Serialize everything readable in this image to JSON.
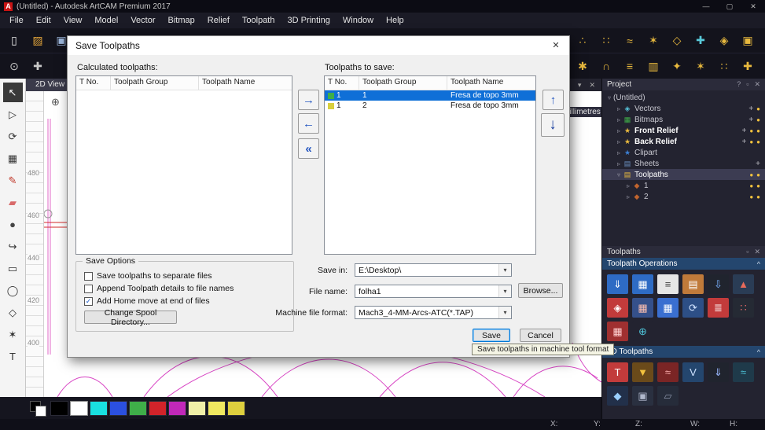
{
  "titlebar": {
    "logo": "A",
    "title": "(Untitled) - Autodesk ArtCAM Premium 2017"
  },
  "icons": {
    "min": "—",
    "max": "▢",
    "close": "✕",
    "help": "?",
    "pin": "▫",
    "dropdown": "▾",
    "collapse": "^",
    "check": "✓"
  },
  "menu": {
    "items": [
      "File",
      "Edit",
      "View",
      "Model",
      "Vector",
      "Bitmap",
      "Relief",
      "Toolpath",
      "3D Printing",
      "Window",
      "Help"
    ]
  },
  "toolbar": {
    "row1_left": [
      {
        "name": "new-model-icon",
        "glyph": "▯",
        "color": "#e8e8e8"
      },
      {
        "name": "open-model-icon",
        "glyph": "▨",
        "color": "#e0a33a"
      },
      {
        "name": "save-model-icon",
        "glyph": "▣",
        "color": "#9ab4d8"
      },
      {
        "name": "import-icon",
        "glyph": "⇩",
        "color": "#8ac08a"
      }
    ],
    "row1_right": [
      {
        "name": "node-editing-icon",
        "glyph": "∴",
        "color": "#e8b93e"
      },
      {
        "name": "add-node-icon",
        "glyph": "∷",
        "color": "#e8b93e"
      },
      {
        "name": "smooth-curve-icon",
        "glyph": "≈",
        "color": "#e8b93e"
      },
      {
        "name": "star-vector-icon",
        "glyph": "✶",
        "color": "#e8b93e"
      },
      {
        "name": "polyline-icon",
        "glyph": "◇",
        "color": "#e8b93e"
      },
      {
        "name": "measure-icon",
        "glyph": "✚",
        "color": "#58c8d8"
      },
      {
        "name": "snap-icon",
        "glyph": "◈",
        "color": "#e8b93e"
      },
      {
        "name": "group-vectors-icon",
        "glyph": "▣",
        "color": "#e8b93e"
      }
    ],
    "row2_left": [
      {
        "name": "zoom-tool-icon",
        "glyph": "⊙",
        "color": "#c8c8c8"
      },
      {
        "name": "pan-tool-icon",
        "glyph": "✚",
        "color": "#c8c8c8"
      }
    ],
    "row2_right": [
      {
        "name": "weld-vectors-icon",
        "glyph": "◉",
        "color": "#e8b93e"
      },
      {
        "name": "trim-vectors-icon",
        "glyph": "✱",
        "color": "#e8b93e"
      },
      {
        "name": "fillet-icon",
        "glyph": "∩",
        "color": "#e8b93e"
      },
      {
        "name": "offset-vector-icon",
        "glyph": "≡",
        "color": "#e8b93e"
      },
      {
        "name": "mirror-vectors-icon",
        "glyph": "▥",
        "color": "#e8b93e"
      },
      {
        "name": "wrap-vectors-icon",
        "glyph": "✦",
        "color": "#e8b93e"
      },
      {
        "name": "nesting-icon",
        "glyph": "✶",
        "color": "#e8b93e"
      },
      {
        "name": "array-copy-icon",
        "glyph": "∷",
        "color": "#e8b93e"
      },
      {
        "name": "join-vectors-icon",
        "glyph": "✚",
        "color": "#e8b93e"
      }
    ]
  },
  "tools": {
    "items": [
      {
        "name": "select-tool",
        "glyph": "↖",
        "active": true
      },
      {
        "name": "node-edit-tool",
        "glyph": "▷"
      },
      {
        "name": "transform-tool",
        "glyph": "⟳"
      },
      {
        "name": "block-copy-tool",
        "glyph": "▦"
      },
      {
        "name": "paint-tool",
        "glyph": "✎",
        "color": "#c0392b"
      },
      {
        "name": "erase-tool",
        "glyph": "▰",
        "color": "#d86a6a"
      },
      {
        "name": "smudge-tool",
        "glyph": "●",
        "color": "#444444"
      },
      {
        "name": "offset-tool",
        "glyph": "↪"
      },
      {
        "name": "rectangle-tool",
        "glyph": "▭"
      },
      {
        "name": "ellipse-tool",
        "glyph": "◯"
      },
      {
        "name": "polygon-tool",
        "glyph": "◇"
      },
      {
        "name": "star-tool",
        "glyph": "✶"
      },
      {
        "name": "text-tool",
        "glyph": "T"
      }
    ]
  },
  "canvas": {
    "view_tab": "2D View -",
    "units": "millimetres",
    "ruler_labels": [
      "480",
      "460",
      "440",
      "420",
      "400"
    ]
  },
  "dialog": {
    "title": "Save Toolpaths",
    "calculated_label": "Calculated toolpaths:",
    "to_save_label": "Toolpaths to save:",
    "columns": [
      "T No.",
      "Toolpath Group",
      "Toolpath Name"
    ],
    "rows": [
      {
        "tno": "1",
        "group": "1",
        "name": "Fresa de topo 3mm",
        "selected": true,
        "icon_color": "#3fae49"
      },
      {
        "tno": "1",
        "group": "2",
        "name": "Fresa de topo 3mm",
        "selected": false,
        "icon_color": "#d8cf3e"
      }
    ],
    "arrows": {
      "right": "→",
      "left": "←",
      "double_left": "«",
      "up": "↑",
      "down": "↓"
    },
    "save_options": {
      "title": "Save Options",
      "checkboxes": [
        {
          "label": "Save toolpaths to separate files",
          "checked": false
        },
        {
          "label": "Append Toolpath details to file names",
          "checked": false
        },
        {
          "label": "Add Home move at end of files",
          "checked": true
        }
      ],
      "spool_button": "Change Spool Directory..."
    },
    "fields": {
      "save_in_label": "Save in:",
      "save_in_value": "E:\\Desktop\\",
      "file_name_label": "File name:",
      "file_name_value": "folha1",
      "browse_button": "Browse...",
      "format_label": "Machine file format:",
      "format_value": "Mach3_4-MM-Arcs-ATC(*.TAP)"
    },
    "save_button": "Save",
    "cancel_button": "Cancel",
    "tooltip": "Save toolpaths in machine tool format"
  },
  "project": {
    "title": "Project",
    "tree": [
      {
        "label": "(Untitled)",
        "level": 0,
        "arrow": "▿"
      },
      {
        "label": "Vectors",
        "level": 1,
        "arrow": "▹",
        "icon": "◈",
        "icon_color": "#57c7de",
        "plus": true,
        "bulbs": 1
      },
      {
        "label": "Bitmaps",
        "level": 1,
        "arrow": "▹",
        "icon": "▦",
        "icon_color": "#3fae49",
        "plus": true,
        "bulbs": 1
      },
      {
        "label": "Front Relief",
        "level": 1,
        "arrow": "▹",
        "icon": "★",
        "icon_color": "#e8b93e",
        "bold": true,
        "plus": true,
        "bulbs": 2
      },
      {
        "label": "Back Relief",
        "level": 1,
        "arrow": "▹",
        "icon": "★",
        "icon_color": "#e8b93e",
        "bold": true,
        "plus": true,
        "bulbs": 2
      },
      {
        "label": "Clipart",
        "level": 1,
        "arrow": "▹",
        "icon": "★",
        "icon_color": "#3b7fd4"
      },
      {
        "label": "Sheets",
        "level": 1,
        "arrow": "▹",
        "icon": "▤",
        "icon_color": "#6a8fc0",
        "plus": true
      },
      {
        "label": "Toolpaths",
        "level": 1,
        "arrow": "▿",
        "icon": "▤",
        "icon_color": "#e8b93e",
        "selected": true,
        "bulbs": 2
      },
      {
        "label": "1",
        "level": 2,
        "arrow": "▹",
        "icon": "◆",
        "icon_color": "#c0642e",
        "bulbs": 2
      },
      {
        "label": "2",
        "level": 2,
        "arrow": "▹",
        "icon": "◆",
        "icon_color": "#c0642e",
        "bulbs": 2
      }
    ]
  },
  "toolpaths_panel": {
    "title": "Toolpaths",
    "ops_title": "Toolpath Operations",
    "ops_icons": [
      {
        "name": "save-toolpaths-icon",
        "glyph": "⇓",
        "fg": "#ffffff",
        "bg": "#2e6bc4"
      },
      {
        "name": "toolpath-summary-icon",
        "glyph": "▦",
        "fg": "#ffffff",
        "bg": "#2e6bc4"
      },
      {
        "name": "toolpath-notes-icon",
        "glyph": "≡",
        "fg": "#444444",
        "bg": "#e6e6e6"
      },
      {
        "name": "toolpath-folder-icon",
        "glyph": "▤",
        "fg": "#ffffff",
        "bg": "#c07a3a"
      },
      {
        "name": "feeds-speeds-icon",
        "glyph": "⇩",
        "fg": "#7ab0ff",
        "bg": "#20242e"
      },
      {
        "name": "simulate-toolpath-icon",
        "glyph": "▲",
        "fg": "#e86a5a",
        "bg": "#2a3c55"
      },
      {
        "name": "delete-simulation-icon",
        "glyph": "◈",
        "fg": "#ffffff",
        "bg": "#c23b3b"
      },
      {
        "name": "material-setup-icon",
        "glyph": "▦",
        "fg": "#ffc0b0",
        "bg": "#35508a"
      },
      {
        "name": "simulation-block-icon",
        "glyph": "▦",
        "fg": "#ffffff",
        "bg": "#3a6fd0"
      },
      {
        "name": "rotate-block-icon",
        "glyph": "⟳",
        "fg": "#cfe2ff",
        "bg": "#2d4f86"
      },
      {
        "name": "toolpath-list-icon",
        "glyph": "≣",
        "fg": "#ffffff",
        "bg": "#c23b3b"
      },
      {
        "name": "preview-quality-icon",
        "glyph": "∷",
        "fg": "#e86a6a",
        "bg": "#252a34"
      },
      {
        "name": "tile-toolpaths-icon",
        "glyph": "▦",
        "fg": "#ffd0d0",
        "bg": "#a03030"
      },
      {
        "name": "set-origin-icon",
        "glyph": "⊕",
        "fg": "#4ec3d8",
        "bg": "#232330"
      }
    ],
    "d2_title": "2D Toolpaths",
    "d2_icons": [
      {
        "name": "profile-toolpath-icon",
        "glyph": "T",
        "fg": "#ffffff",
        "bg": "#c23b3b"
      },
      {
        "name": "drill-toolpath-icon",
        "glyph": "▼",
        "fg": "#f2c23e",
        "bg": "#6a4a1a"
      },
      {
        "name": "area-clearance-icon",
        "glyph": "≈",
        "fg": "#ffb0b0",
        "bg": "#7a2525"
      },
      {
        "name": "vcarve-toolpath-icon",
        "glyph": "V",
        "fg": "#cfe2ff",
        "bg": "#24466e"
      },
      {
        "name": "drill-bank-icon",
        "glyph": "⇓",
        "fg": "#9ab8ff",
        "bg": "#20242e"
      },
      {
        "name": "texture-toolpath-icon",
        "glyph": "≈",
        "fg": "#4ec3d8",
        "bg": "#1f3a4a"
      },
      {
        "name": "profile-3d-icon",
        "glyph": "◆",
        "fg": "#9ad0ff",
        "bg": "#22304a"
      },
      {
        "name": "relief-machining-icon",
        "glyph": "▣",
        "fg": "#b0b8cc",
        "bg": "#2a3040"
      },
      {
        "name": "fluting-toolpath-icon",
        "glyph": "▱",
        "fg": "#8a93a8",
        "bg": "#262c3a"
      }
    ]
  },
  "palette": {
    "colors": [
      "#000000",
      "#ffffff",
      "#19e0e0",
      "#2b50e0",
      "#3fae49",
      "#d2232a",
      "#c128b9",
      "#f0f0a8",
      "#f0e860",
      "#decf3e"
    ]
  },
  "status": {
    "labels": [
      "X:",
      "Y:",
      "Z:",
      "W:",
      "H:"
    ]
  }
}
